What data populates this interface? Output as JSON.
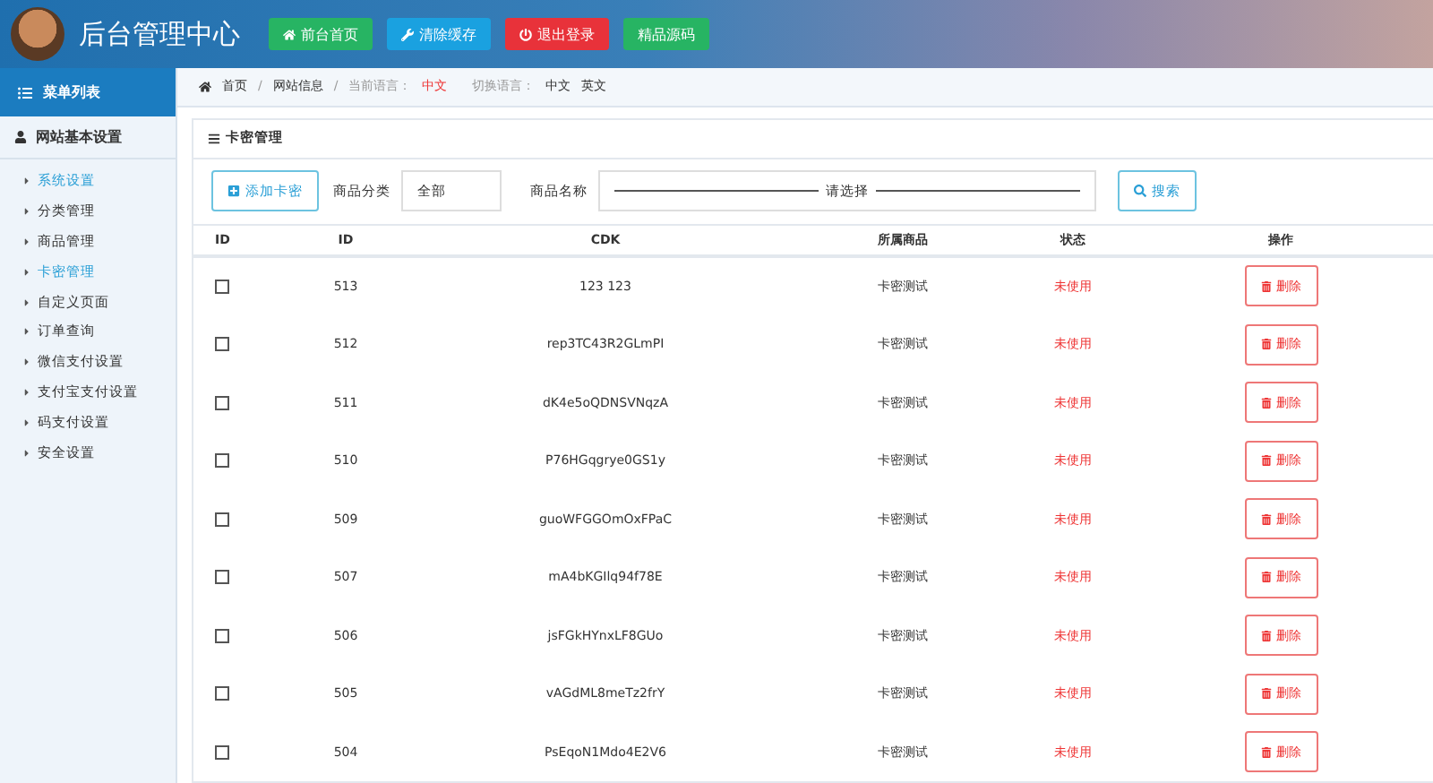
{
  "header": {
    "title": "后台管理中心",
    "buttons": [
      {
        "label": "前台首页",
        "kind": "home"
      },
      {
        "label": "清除缓存",
        "kind": "wrench"
      },
      {
        "label": "退出登录",
        "kind": "power"
      },
      {
        "label": "精品源码",
        "kind": "plain"
      }
    ]
  },
  "sidebar": {
    "title": "菜单列表",
    "group": "网站基本设置",
    "items": [
      {
        "label": "系统设置",
        "selected": true
      },
      {
        "label": "分类管理",
        "selected": false
      },
      {
        "label": "商品管理",
        "selected": false
      },
      {
        "label": "卡密管理",
        "selected": true
      },
      {
        "label": "自定义页面",
        "selected": false
      },
      {
        "label": "订单查询",
        "selected": false
      },
      {
        "label": "微信支付设置",
        "selected": false
      },
      {
        "label": "支付宝支付设置",
        "selected": false
      },
      {
        "label": "码支付设置",
        "selected": false
      },
      {
        "label": "安全设置",
        "selected": false
      }
    ]
  },
  "breadcrumb": {
    "separators": [
      "/",
      "/"
    ],
    "home": "首页",
    "page": "网站信息",
    "lang_label": "当前语言：",
    "lang_value": "中文",
    "switch_label": "切换语言：",
    "langs": [
      "中文",
      "英文"
    ]
  },
  "panel": {
    "title": "卡密管理",
    "add_button": "添加卡密",
    "category_label": "商品分类",
    "category_value": "全部",
    "name_label": "商品名称",
    "name_placeholder": "请选择",
    "search_button": "搜索"
  },
  "table": {
    "columns": [
      "ID",
      "ID",
      "CDK",
      "所属商品",
      "状态",
      "操作"
    ],
    "rows": [
      {
        "checked": false,
        "id": "513",
        "cdk": "123 123",
        "product": "卡密测试",
        "status": "未使用",
        "action": "删除"
      },
      {
        "checked": false,
        "id": "512",
        "cdk": "rep3TC43R2GLmPI",
        "product": "卡密测试",
        "status": "未使用",
        "action": "删除"
      },
      {
        "checked": false,
        "id": "511",
        "cdk": "dK4e5oQDNSVNqzA",
        "product": "卡密测试",
        "status": "未使用",
        "action": "删除"
      },
      {
        "checked": false,
        "id": "510",
        "cdk": "P76HGqgrye0GS1y",
        "product": "卡密测试",
        "status": "未使用",
        "action": "删除"
      },
      {
        "checked": false,
        "id": "509",
        "cdk": "guoWFGGOmOxFPaC",
        "product": "卡密测试",
        "status": "未使用",
        "action": "删除"
      },
      {
        "checked": false,
        "id": "507",
        "cdk": "mA4bKGIlq94f78E",
        "product": "卡密测试",
        "status": "未使用",
        "action": "删除"
      },
      {
        "checked": false,
        "id": "506",
        "cdk": "jsFGkHYnxLF8GUo",
        "product": "卡密测试",
        "status": "未使用",
        "action": "删除"
      },
      {
        "checked": false,
        "id": "505",
        "cdk": "vAGdML8meTz2frY",
        "product": "卡密测试",
        "status": "未使用",
        "action": "删除"
      },
      {
        "checked": false,
        "id": "504",
        "cdk": "PsEqoN1Mdo4E2V6",
        "product": "卡密测试",
        "status": "未使用",
        "action": "删除"
      }
    ]
  }
}
